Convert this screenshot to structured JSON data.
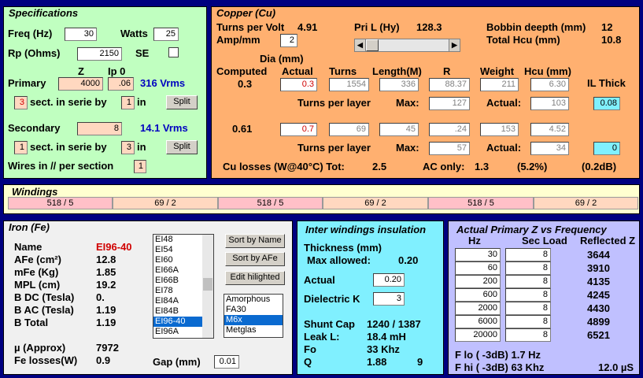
{
  "colors": {
    "spec_bg": "#c0ffc0",
    "copper_bg": "#ffb070",
    "windings_bg": "#ffffd0",
    "iron_bg": "#f0f0f0",
    "insul_bg": "#80f0ff",
    "freq_bg": "#c0c0ff"
  },
  "spec": {
    "title": "Specifications",
    "freq_label": "Freq (Hz)",
    "freq": "30",
    "watts_label": "Watts",
    "watts": "25",
    "rp_label": "Rp (Ohms)",
    "rp": "2150",
    "se_label": "SE",
    "z_hdr": "Z",
    "ip_hdr": "Ip 0",
    "primary_label": "Primary",
    "primary_z": "4000",
    "primary_ip": ".06",
    "primary_vrms": "316 Vrms",
    "p_sect": "3",
    "sect_text": "sect. in serie by",
    "p_par": "1",
    "in_text": "in",
    "split": "Split",
    "secondary_label": "Secondary",
    "secondary_z": "8",
    "secondary_vrms": "14.1 Vrms",
    "s_sect": "1",
    "s_par": "3",
    "wires_label": "Wires in // per section",
    "wires": "1"
  },
  "copper": {
    "title": "Copper (Cu)",
    "tpv_label": "Turns per Volt",
    "tpv": "4.91",
    "pril_label": "Pri L (Hy)",
    "pril": "128.3",
    "bobbin_label": "Bobbin deepth (mm)",
    "bobbin": "12",
    "hcu_total_label": "Total Hcu (mm)",
    "hcu_total": "10.8",
    "amp_label": "Amp/mm",
    "amp": "2",
    "dia_label": "Dia (mm)",
    "hdr": {
      "computed": "Computed",
      "actual": "Actual",
      "turns": "Turns",
      "length": "Length(M)",
      "r": "R",
      "weight": "Weight",
      "hcu": "Hcu (mm)",
      "ilthick": "IL Thick"
    },
    "pri": {
      "computed": "0.3",
      "actual": "0.3",
      "turns": "1554",
      "length": "336",
      "r": "88.37",
      "weight": "211",
      "hcu": "6.30",
      "tpl_label": "Turns per layer",
      "max_label": "Max:",
      "max": "127",
      "actual_label": "Actual:",
      "actual_tpl": "103",
      "il": "0.08"
    },
    "sec": {
      "computed": "0.61",
      "actual": "0.7",
      "turns": "69",
      "length": "45",
      "r": ".24",
      "weight": "153",
      "hcu": "4.52",
      "max": "57",
      "actual_tpl": "34",
      "il": "0"
    },
    "losses_label": "Cu losses (W@40°C) Tot:",
    "losses_tot": "2.5",
    "ac_label": "AC only:",
    "ac": "1.3",
    "pct": "(5.2%)",
    "db": "(0.2dB)"
  },
  "windings": {
    "title": "Windings",
    "cells": [
      "518 / 5",
      "69 / 2",
      "518 / 5",
      "69 / 2",
      "518 / 5",
      "69 / 2"
    ]
  },
  "iron": {
    "title": "Iron (Fe)",
    "name_label": "Name",
    "name": "EI96-40",
    "afe_label": "AFe (cm²)",
    "afe": "12.8",
    "mfe_label": "mFe (Kg)",
    "mfe": "1.85",
    "mpl_label": "MPL (cm)",
    "mpl": "19.2",
    "bdc_label": "B DC (Tesla)",
    "bdc": "0.",
    "bac_label": "B AC (Tesla)",
    "bac": "1.19",
    "btot_label": "B Total",
    "btot": "1.19",
    "mu_label": "µ (Approx)",
    "mu": "7972",
    "felosses_label": "Fe losses(W)",
    "felosses": "0.9",
    "gap_label": "Gap (mm)",
    "gap": "0.01",
    "cores": [
      "EI48",
      "EI54",
      "EI60",
      "EI66A",
      "EI66B",
      "EI78",
      "EI84A",
      "EI84B",
      "EI96-40",
      "EI96A"
    ],
    "sort_name": "Sort by Name",
    "sort_afe": "Sort by AFe",
    "edit": "Edit hilighted",
    "materials": [
      "Amorphous",
      "FA30",
      "M6x",
      "Metglas"
    ]
  },
  "insul": {
    "title": "Inter windings insulation",
    "thick_label": "Thickness (mm)",
    "maxallowed_label": "Max allowed:",
    "maxallowed": "0.20",
    "actual_label": "Actual",
    "actual": "0.20",
    "dielec_label": "Dielectric K",
    "dielec": "3",
    "shunt_label": "Shunt Cap",
    "shunt": "1240 / 1387",
    "leak_label": "Leak L:",
    "leak": "18.4 mH",
    "fo_label": "Fo",
    "fo": "33 Khz",
    "q_label": "Q",
    "q": "1.88",
    "q2": "9"
  },
  "freq": {
    "title": "Actual Primary Z vs Frequency",
    "hz_hdr": "Hz",
    "load_hdr": "Sec Load",
    "refl_hdr": "Reflected Z",
    "rows": [
      {
        "hz": "30",
        "load": "8",
        "z": "3644"
      },
      {
        "hz": "60",
        "load": "8",
        "z": "3910"
      },
      {
        "hz": "200",
        "load": "8",
        "z": "4135"
      },
      {
        "hz": "600",
        "load": "8",
        "z": "4245"
      },
      {
        "hz": "2000",
        "load": "8",
        "z": "4430"
      },
      {
        "hz": "6000",
        "load": "8",
        "z": "4899"
      },
      {
        "hz": "20000",
        "load": "8",
        "z": "6521"
      }
    ],
    "flo": "F lo ( -3dB) 1.7 Hz",
    "fhi": "F hi ( -3dB) 63 Khz",
    "rise": "12.0 µS"
  }
}
